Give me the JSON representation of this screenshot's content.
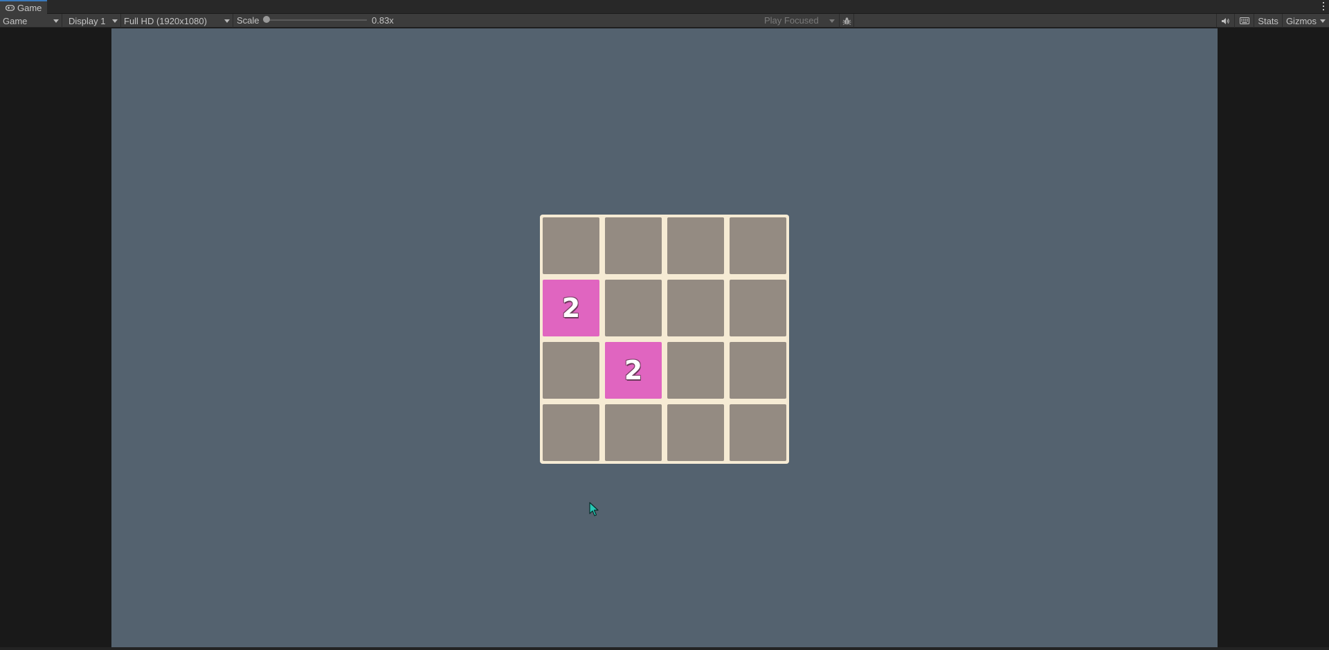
{
  "window": {
    "tab_title": "Game"
  },
  "toolbar": {
    "view_mode": "Game",
    "display": "Display 1",
    "resolution": "Full HD (1920x1080)",
    "scale_label": "Scale",
    "scale_value": "0.83x",
    "play_mode": "Play Focused",
    "stats_label": "Stats",
    "gizmos_label": "Gizmos"
  },
  "game": {
    "board_size": 4,
    "tiles": [
      [
        "",
        "",
        "",
        ""
      ],
      [
        "2",
        "",
        "",
        ""
      ],
      [
        "",
        "2",
        "",
        ""
      ],
      [
        "",
        "",
        "",
        ""
      ]
    ],
    "colors": {
      "background": "#54626f",
      "board": "#f6ebd4",
      "empty_cell": "#948b82",
      "tile_2": "#e065c0"
    }
  }
}
